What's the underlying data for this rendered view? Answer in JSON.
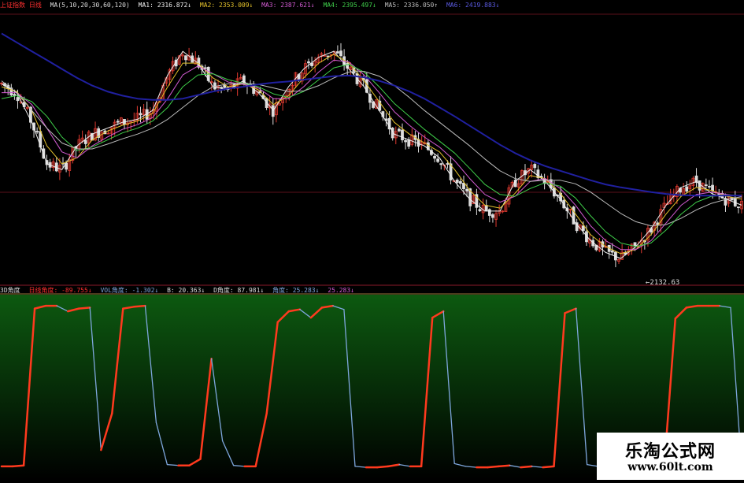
{
  "colors": {
    "background": "#000000",
    "indicator_bg_top": "#0d5a10",
    "indicator_bg_bottom": "#000000",
    "divider": "#8a1a2a",
    "rise": "#e03a30",
    "fall": "#dcdcdc",
    "ma1": "#f0f0f0",
    "ma2": "#e3c12b",
    "ma3": "#d25bd2",
    "ma4": "#3fcf4a",
    "ma5": "#bbbbbb",
    "ma6": "#2020a0",
    "angle_up": "#ff3a1e",
    "angle_down": "#7ea6dc"
  },
  "top_header": {
    "title": "上证指数 日线",
    "params": "MA(5,10,20,30,60,120)",
    "ma1": "MA1: 2316.872↓",
    "ma2": "MA2: 2353.009↓",
    "ma3": "MA3: 2387.621↓",
    "ma4": "MA4: 2395.497↓",
    "ma5": "MA5: 2336.050↑",
    "ma6": "MA6: 2419.883↓"
  },
  "bottom_header": {
    "title": "3D角度",
    "f1": "日线角度: -89.755↓",
    "f2": "VOL角度: -1.302↓",
    "f3": "B: 20.363↓",
    "f4": "D角度: 87.981↓",
    "f5": "角度: 25.283↓",
    "f6": "25.283↓"
  },
  "annotations": {
    "low_label": "2132.63",
    "low_arrow": "←"
  },
  "watermark": {
    "name": "乐淘公式网",
    "url": "www.60lt.com"
  },
  "chart_data": [
    {
      "type": "line",
      "title": "上证指数 日线",
      "xlabel": "",
      "ylabel": "",
      "ylim": [
        2110,
        2560
      ],
      "grid": false,
      "series": [
        {
          "name": "MA1",
          "values": [
            2445,
            2430,
            2380,
            2310,
            2300,
            2340,
            2360,
            2370,
            2380,
            2385,
            2400,
            2460,
            2500,
            2480,
            2440,
            2435,
            2450,
            2430,
            2400,
            2440,
            2470,
            2490,
            2500,
            2470,
            2440,
            2400,
            2360,
            2350,
            2340,
            2320,
            2280,
            2250,
            2230,
            2230,
            2280,
            2300,
            2280,
            2250,
            2210,
            2180,
            2160,
            2150,
            2170,
            2200,
            2240,
            2270,
            2280,
            2260,
            2250,
            2240
          ]
        },
        {
          "name": "MA2",
          "values": [
            2440,
            2432,
            2400,
            2340,
            2310,
            2320,
            2350,
            2365,
            2375,
            2382,
            2395,
            2440,
            2480,
            2480,
            2455,
            2440,
            2445,
            2435,
            2410,
            2425,
            2455,
            2480,
            2495,
            2480,
            2450,
            2415,
            2380,
            2360,
            2345,
            2330,
            2300,
            2265,
            2240,
            2235,
            2260,
            2290,
            2285,
            2260,
            2225,
            2190,
            2170,
            2158,
            2165,
            2190,
            2225,
            2255,
            2270,
            2265,
            2255,
            2250
          ]
        },
        {
          "name": "MA3",
          "values": [
            2430,
            2430,
            2410,
            2370,
            2330,
            2320,
            2340,
            2355,
            2368,
            2376,
            2388,
            2420,
            2460,
            2475,
            2462,
            2448,
            2444,
            2438,
            2420,
            2420,
            2440,
            2465,
            2485,
            2482,
            2460,
            2430,
            2398,
            2375,
            2355,
            2338,
            2315,
            2285,
            2258,
            2245,
            2255,
            2280,
            2285,
            2268,
            2240,
            2205,
            2180,
            2165,
            2165,
            2180,
            2210,
            2240,
            2258,
            2262,
            2258,
            2255
          ]
        },
        {
          "name": "MA4",
          "values": [
            2420,
            2425,
            2415,
            2390,
            2355,
            2332,
            2338,
            2350,
            2362,
            2370,
            2382,
            2405,
            2440,
            2460,
            2462,
            2452,
            2446,
            2440,
            2428,
            2422,
            2432,
            2452,
            2472,
            2478,
            2465,
            2440,
            2412,
            2390,
            2368,
            2348,
            2328,
            2302,
            2275,
            2258,
            2255,
            2268,
            2278,
            2272,
            2252,
            2222,
            2195,
            2176,
            2170,
            2176,
            2198,
            2225,
            2245,
            2255,
            2257,
            2256
          ]
        },
        {
          "name": "MA5",
          "values": [
            2450,
            2430,
            2400,
            2370,
            2345,
            2335,
            2335,
            2343,
            2352,
            2360,
            2370,
            2385,
            2405,
            2425,
            2440,
            2445,
            2446,
            2444,
            2438,
            2432,
            2433,
            2442,
            2455,
            2465,
            2466,
            2458,
            2442,
            2422,
            2400,
            2380,
            2360,
            2340,
            2318,
            2298,
            2285,
            2280,
            2282,
            2282,
            2276,
            2262,
            2244,
            2226,
            2212,
            2205,
            2207,
            2218,
            2232,
            2243,
            2250,
            2254
          ]
        },
        {
          "name": "MA6",
          "values": [
            2530,
            2515,
            2500,
            2485,
            2470,
            2455,
            2442,
            2432,
            2425,
            2420,
            2418,
            2418,
            2420,
            2426,
            2432,
            2437,
            2440,
            2444,
            2447,
            2449,
            2452,
            2455,
            2458,
            2459,
            2456,
            2450,
            2442,
            2432,
            2420,
            2405,
            2390,
            2374,
            2358,
            2342,
            2328,
            2316,
            2306,
            2298,
            2290,
            2282,
            2275,
            2270,
            2266,
            2262,
            2259,
            2257,
            2256,
            2256,
            2256,
            2256
          ]
        }
      ],
      "annotations": [
        "2132.63"
      ]
    },
    {
      "type": "line",
      "title": "3D角度",
      "xlabel": "",
      "ylabel": "",
      "ylim": [
        -95,
        95
      ],
      "grid": false,
      "series": [
        {
          "name": "角度",
          "values": [
            -88,
            -88,
            -87,
            85,
            88,
            88,
            82,
            85,
            86,
            -70,
            -30,
            85,
            87,
            88,
            -40,
            -86,
            -87,
            -87,
            -80,
            30,
            -60,
            -87,
            -88,
            -88,
            -30,
            70,
            82,
            84,
            75,
            86,
            88,
            84,
            -88,
            -89,
            -89,
            -88,
            -86,
            -88,
            -88,
            75,
            82,
            -85,
            -88,
            -89,
            -89,
            -88,
            -87,
            -89,
            -88,
            -89,
            -88,
            80,
            85,
            -86,
            -88,
            -88,
            -89,
            -89,
            -88,
            -88,
            -87,
            74,
            86,
            88,
            88,
            88,
            86,
            -89
          ]
        }
      ]
    }
  ]
}
